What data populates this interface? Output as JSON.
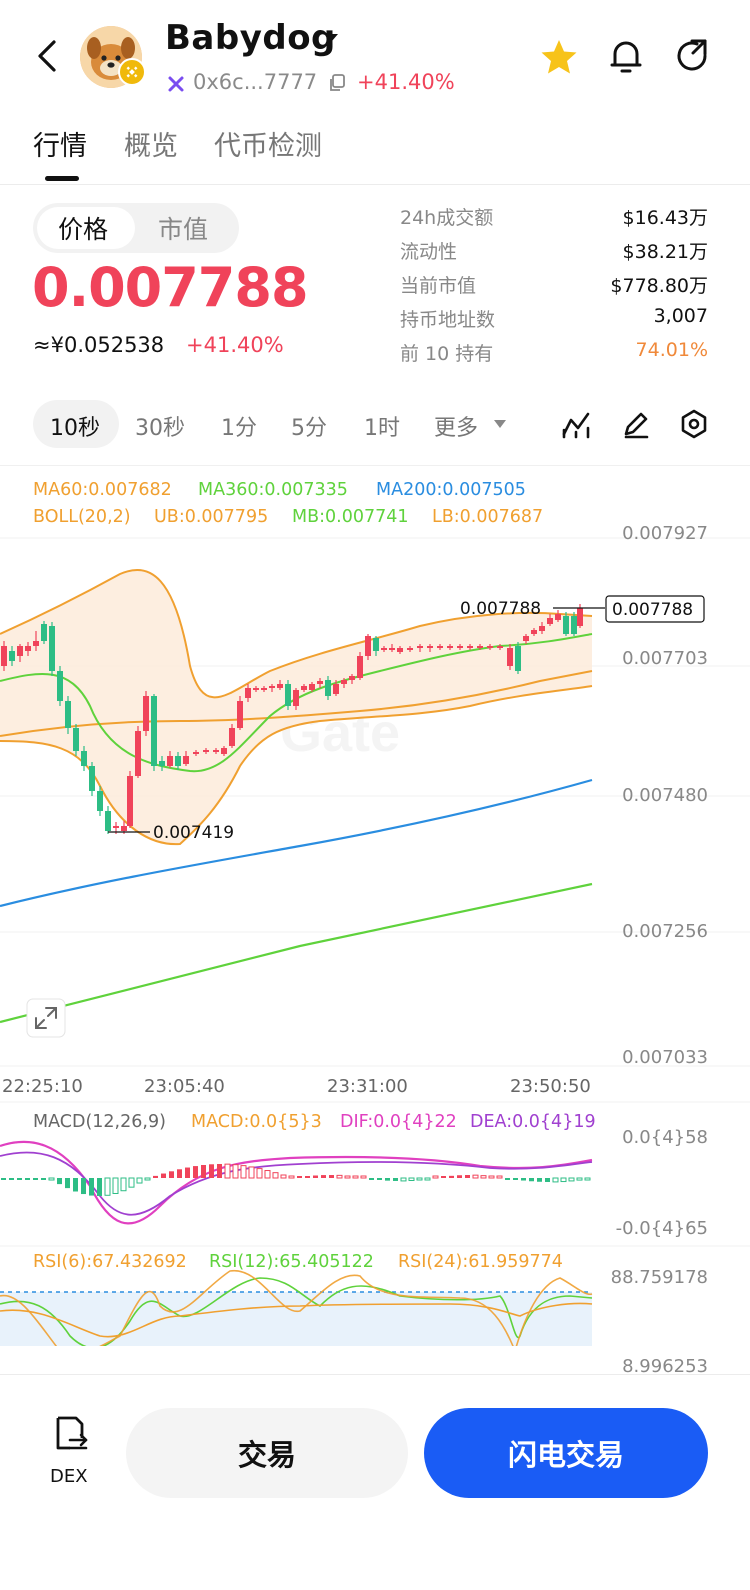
{
  "header": {
    "title": "Babydog",
    "address": "0x6c...7777",
    "change": "+41.40%"
  },
  "tabs": [
    {
      "label": "行情",
      "active": true
    },
    {
      "label": "概览",
      "active": false
    },
    {
      "label": "代币检测",
      "active": false
    }
  ],
  "price_toggle": {
    "price_label": "价格",
    "mcap_label": "市值"
  },
  "price": {
    "value": "0.007788",
    "cny": "≈¥0.052538",
    "change": "+41.40%"
  },
  "stats": [
    {
      "label": "24h成交额",
      "value": "$16.43万"
    },
    {
      "label": "流动性",
      "value": "$38.21万"
    },
    {
      "label": "当前市值",
      "value": "$778.80万"
    },
    {
      "label": "持币地址数",
      "value": "3,007"
    },
    {
      "label": "前 10 持有",
      "value": "74.01%"
    }
  ],
  "intervals": [
    "10秒",
    "30秒",
    "1分",
    "5分",
    "1时",
    "更多"
  ],
  "chart": {
    "ma_legend": [
      "MA60:0.007682",
      "MA360:0.007335",
      "MA200:0.007505"
    ],
    "boll_legend": [
      "BOLL(20,2)",
      "UB:0.007795",
      "MB:0.007741",
      "LB:0.007687"
    ],
    "y_ticks": [
      "0.007927",
      "0.007703",
      "0.007480",
      "0.007256",
      "0.007033"
    ],
    "x_ticks": [
      "22:25:10",
      "23:05:40",
      "23:31:00",
      "23:50:50"
    ],
    "high_label": "0.007788",
    "last_price": "0.007788",
    "low_label": "0.007419",
    "watermark": "Gate",
    "colors": {
      "up": "#f0435a",
      "down": "#2dbd85",
      "ma60": "#f0a030",
      "ma360": "#5fd23c",
      "ma200": "#2a8de0",
      "boll": "#f0a030"
    }
  },
  "macd": {
    "legend": [
      "MACD(12,26,9)",
      "MACD:0.0{5}3",
      "DIF:0.0{4}22",
      "DEA:0.0{4}19"
    ],
    "y_ticks": [
      "0.0{4}58",
      "-0.0{4}65"
    ]
  },
  "rsi": {
    "legend": [
      "RSI(6):67.432692",
      "RSI(12):65.405122",
      "RSI(24):61.959774"
    ],
    "y_ticks": [
      "88.759178",
      "8.996253"
    ]
  },
  "bottom": {
    "dex_label": "DEX",
    "trade_label": "交易",
    "flash_label": "闪电交易"
  }
}
